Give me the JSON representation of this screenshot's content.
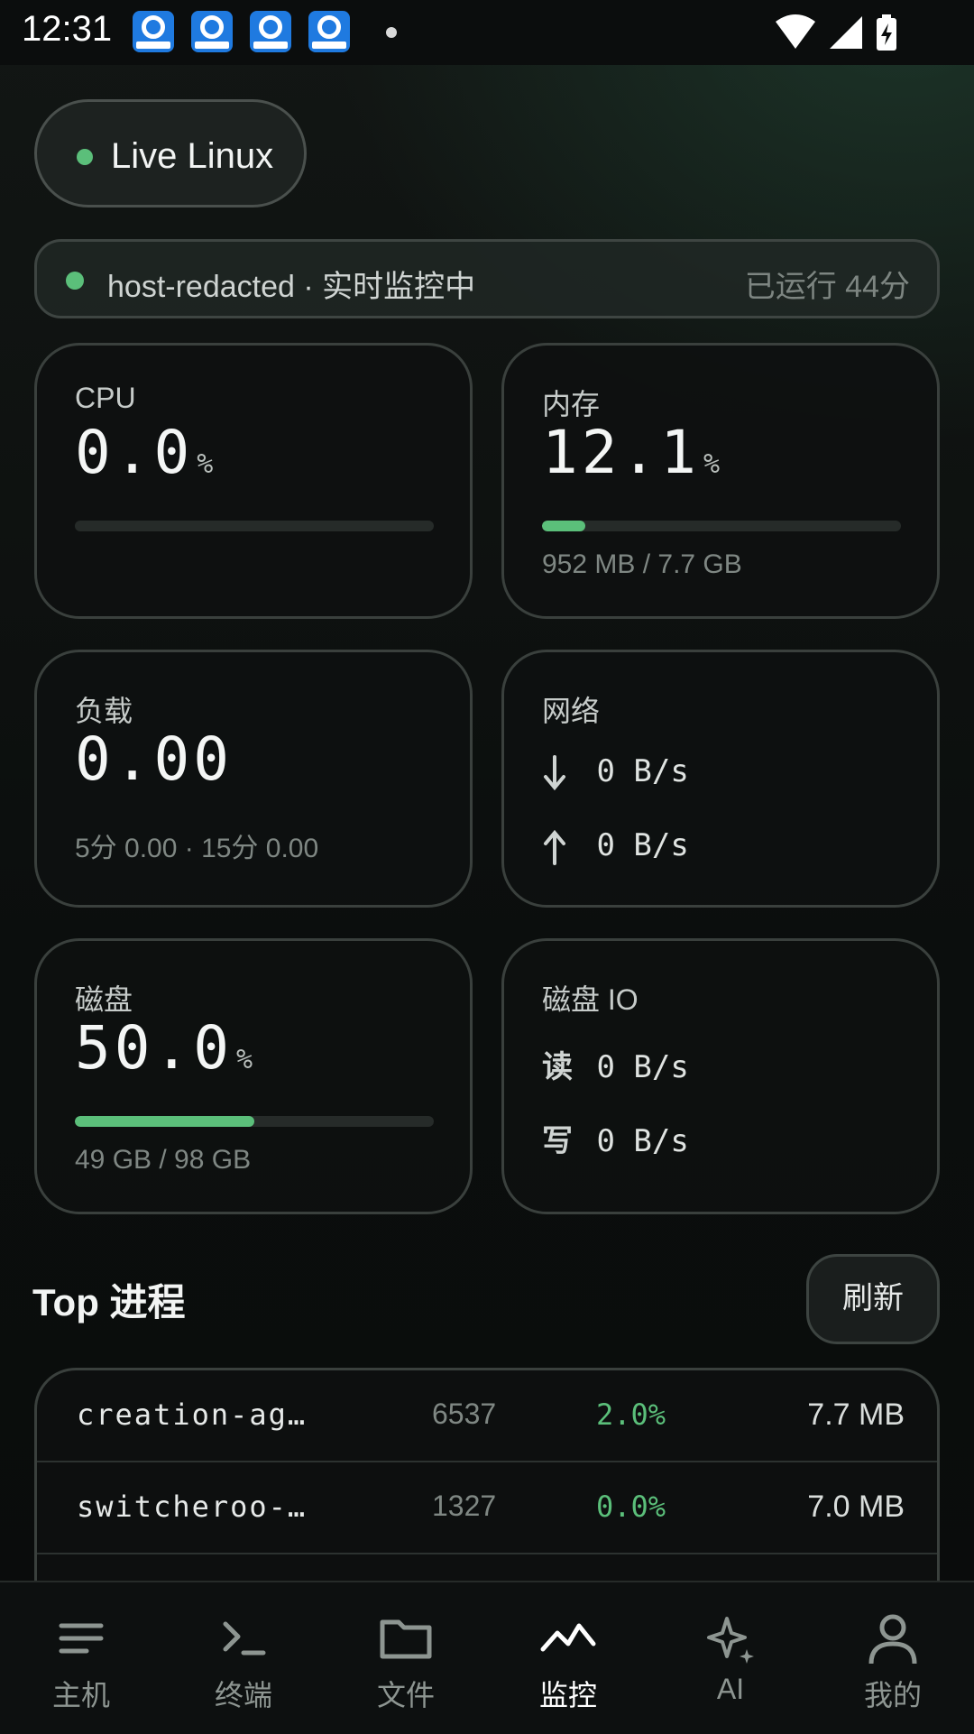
{
  "status_bar": {
    "time": "12:31"
  },
  "chip": {
    "label": "Live Linux"
  },
  "host": {
    "text": "host-redacted · 实时监控中",
    "uptime": "已运行 44分"
  },
  "cards": {
    "cpu": {
      "label": "CPU",
      "value": "0.0",
      "unit": "%",
      "usage_fraction": 0.0
    },
    "memory": {
      "label": "内存",
      "value": "12.1",
      "unit": "%",
      "usage_fraction": 0.121,
      "detail": "952 MB / 7.7 GB"
    },
    "load": {
      "label": "负载",
      "value": "0.00",
      "detail": "5分 0.00 · 15分 0.00"
    },
    "network": {
      "label": "网络",
      "down": "0 B/s",
      "up": "0 B/s"
    },
    "disk": {
      "label": "磁盘",
      "value": "50.0",
      "unit": "%",
      "usage_fraction": 0.5,
      "detail": "49 GB / 98 GB"
    },
    "disk_io": {
      "label": "磁盘 IO",
      "read_label": "读",
      "read": "0 B/s",
      "write_label": "写",
      "write": "0 B/s"
    }
  },
  "processes": {
    "title": "Top 进程",
    "refresh_label": "刷新",
    "rows": [
      {
        "name": "creation-ag…",
        "pid": "6537",
        "cpu": "2.0%",
        "mem": "7.7 MB"
      },
      {
        "name": "switcheroo-…",
        "pid": "1327",
        "cpu": "0.0%",
        "mem": "7.0 MB"
      }
    ]
  },
  "nav": {
    "items": [
      {
        "label": "主机",
        "icon": "menu-lines-icon"
      },
      {
        "label": "终端",
        "icon": "terminal-icon"
      },
      {
        "label": "文件",
        "icon": "folder-icon"
      },
      {
        "label": "监控",
        "icon": "activity-icon",
        "active": true
      },
      {
        "label": "AI",
        "icon": "sparkle-icon"
      },
      {
        "label": "我的",
        "icon": "person-icon"
      }
    ]
  },
  "colors": {
    "accent": "#5bbf7a",
    "background": "#0b0e0d",
    "card_border": "#3a403d"
  }
}
